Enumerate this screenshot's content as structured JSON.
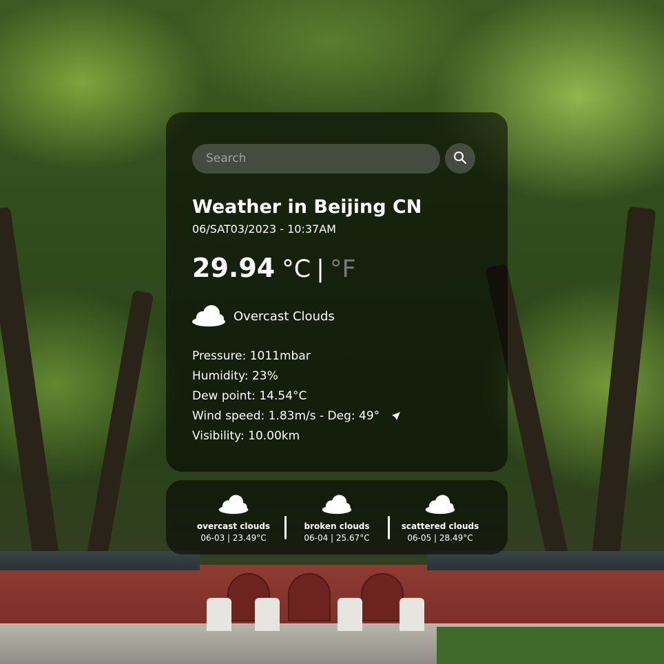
{
  "search": {
    "placeholder": "Search"
  },
  "weather": {
    "title": "Weather in Beijing CN",
    "datetime": "06/SAT03/2023 - 10:37AM",
    "temperature": "29.94",
    "unit_c": "°C",
    "unit_separator": "|",
    "unit_f": "°F",
    "condition": "Overcast Clouds",
    "condition_icon": "cloud-icon",
    "details": {
      "pressure": "Pressure: 1011mbar",
      "humidity": "Humidity: 23%",
      "dew_point": "Dew point: 14.54°C",
      "wind": "Wind speed: 1.83m/s - Deg: 49°",
      "visibility": "Visibility: 10.00km"
    }
  },
  "forecast": [
    {
      "description": "overcast clouds",
      "date_temp": "06-03 | 23.49°C",
      "icon": "cloud-icon"
    },
    {
      "description": "broken clouds",
      "date_temp": "06-04 | 25.67°C",
      "icon": "cloud-icon"
    },
    {
      "description": "scattered clouds",
      "date_temp": "06-05 | 28.49°C",
      "icon": "cloud-icon"
    }
  ],
  "colors": {
    "card_background": "#000000",
    "unit_inactive": "#7a7a7a",
    "text": "#ffffff"
  }
}
